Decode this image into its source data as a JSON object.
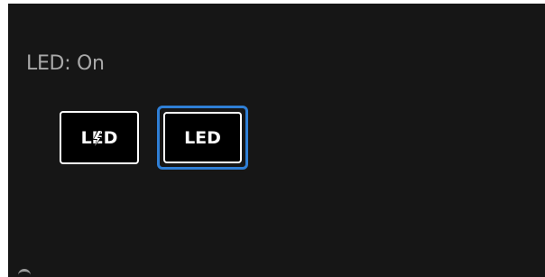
{
  "status": {
    "text": "LED: On"
  },
  "buttons": {
    "led_toggle_label": "LED",
    "led_label": "LED"
  },
  "colors": {
    "panel_background": "#161616",
    "status_text": "#a9a9a9",
    "button_background": "#000000",
    "button_border": "#ffffff",
    "focus_ring": "#2f7fd6"
  },
  "icons": {
    "led_toggle_overlay": "lightning-bolt-icon"
  },
  "state": {
    "led_on": true,
    "focused_button": "led-button"
  }
}
